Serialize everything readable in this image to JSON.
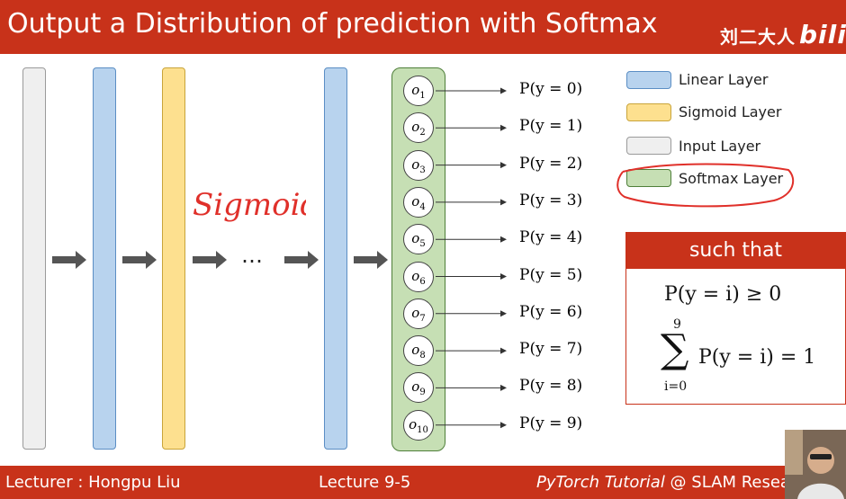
{
  "title": "Output a Distribution of prediction with Softmax",
  "watermark": {
    "text": "刘二大人",
    "logo": "bilib"
  },
  "colors": {
    "accent": "#c8321a",
    "linear": "#b8d3ee",
    "sigmoid": "#fde08f",
    "input": "#efefef",
    "softmax": "#c6dfb4"
  },
  "diagram": {
    "dots": "…",
    "handwritten_note": "Sigmoid",
    "nodes": [
      {
        "base": "o",
        "sub": "1"
      },
      {
        "base": "o",
        "sub": "2"
      },
      {
        "base": "o",
        "sub": "3"
      },
      {
        "base": "o",
        "sub": "4"
      },
      {
        "base": "o",
        "sub": "5"
      },
      {
        "base": "o",
        "sub": "6"
      },
      {
        "base": "o",
        "sub": "7"
      },
      {
        "base": "o",
        "sub": "8"
      },
      {
        "base": "o",
        "sub": "9"
      },
      {
        "base": "o",
        "sub": "10"
      }
    ],
    "outputs": [
      "P(y = 0)",
      "P(y = 1)",
      "P(y = 2)",
      "P(y = 3)",
      "P(y = 4)",
      "P(y = 5)",
      "P(y = 6)",
      "P(y = 7)",
      "P(y = 8)",
      "P(y = 9)"
    ]
  },
  "legend": {
    "linear": "Linear Layer",
    "sigmoid": "Sigmoid Layer",
    "input": "Input Layer",
    "softmax": "Softmax Layer"
  },
  "constraints": {
    "header": "such that",
    "line1": "P(y = i) ≥ 0",
    "sum_upper": "9",
    "sum_symbol": "∑",
    "sum_lower": "i=0",
    "line2_body": "P(y = i) = 1"
  },
  "footer": {
    "lecturer": "Lecturer : Hongpu Liu",
    "lecture": "Lecture 9-5",
    "course_italic": "PyTorch Tutorial",
    "course_rest": " @ SLAM Resea"
  }
}
